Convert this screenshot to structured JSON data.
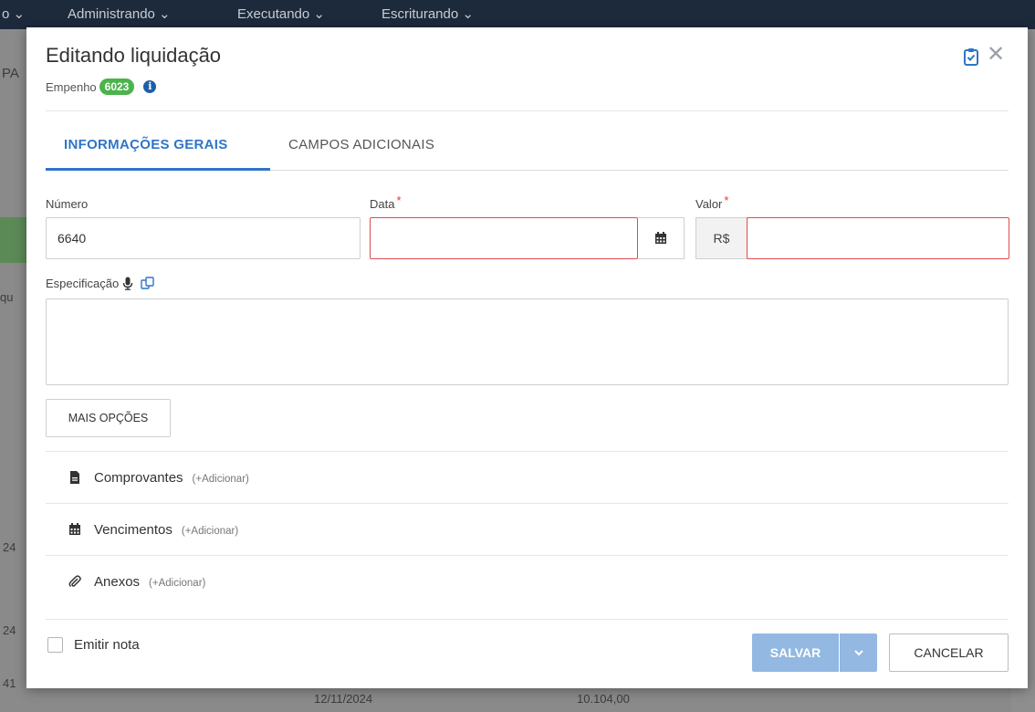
{
  "topbar": {
    "menus": [
      {
        "label": "o"
      },
      {
        "label": "Administrando"
      },
      {
        "label": "Executando"
      },
      {
        "label": "Escriturando"
      }
    ]
  },
  "background": {
    "left_fragments": [
      "PA",
      "qu",
      "24",
      "24",
      "41"
    ],
    "bottom_fragments": [
      "12/11/2024",
      "10.104,00"
    ]
  },
  "modal": {
    "title": "Editando liquidação",
    "subtitle_label": "Empenho",
    "empenho_number": "6023",
    "close_symbol": "✕",
    "tabs": [
      {
        "label": "INFORMAÇÕES GERAIS",
        "active": true
      },
      {
        "label": "CAMPOS ADICIONAIS",
        "active": false
      }
    ],
    "fields": {
      "numero": {
        "label": "Número",
        "value": "6640"
      },
      "data": {
        "label": "Data",
        "required_mark": "*",
        "value": ""
      },
      "valor": {
        "label": "Valor",
        "required_mark": "*",
        "prefix": "R$",
        "value": ""
      },
      "especificacao": {
        "label": "Especificação",
        "value": ""
      }
    },
    "more_options_label": "MAIS OPÇÕES",
    "sections": [
      {
        "label": "Comprovantes",
        "add_label": "(+Adicionar)",
        "icon": "file-icon"
      },
      {
        "label": "Vencimentos",
        "add_label": "(+Adicionar)",
        "icon": "calendar-icon"
      },
      {
        "label": "Anexos",
        "add_label": "(+Adicionar)",
        "icon": "paperclip-icon"
      }
    ],
    "emit_note_label": "Emitir nota",
    "save_label": "SALVAR",
    "cancel_label": "CANCELAR"
  },
  "colors": {
    "accent": "#2e75c7",
    "badge": "#4bb34b",
    "error": "#e04b4b",
    "save_button": "#93b8e2",
    "topbar": "#1d2a3c"
  }
}
